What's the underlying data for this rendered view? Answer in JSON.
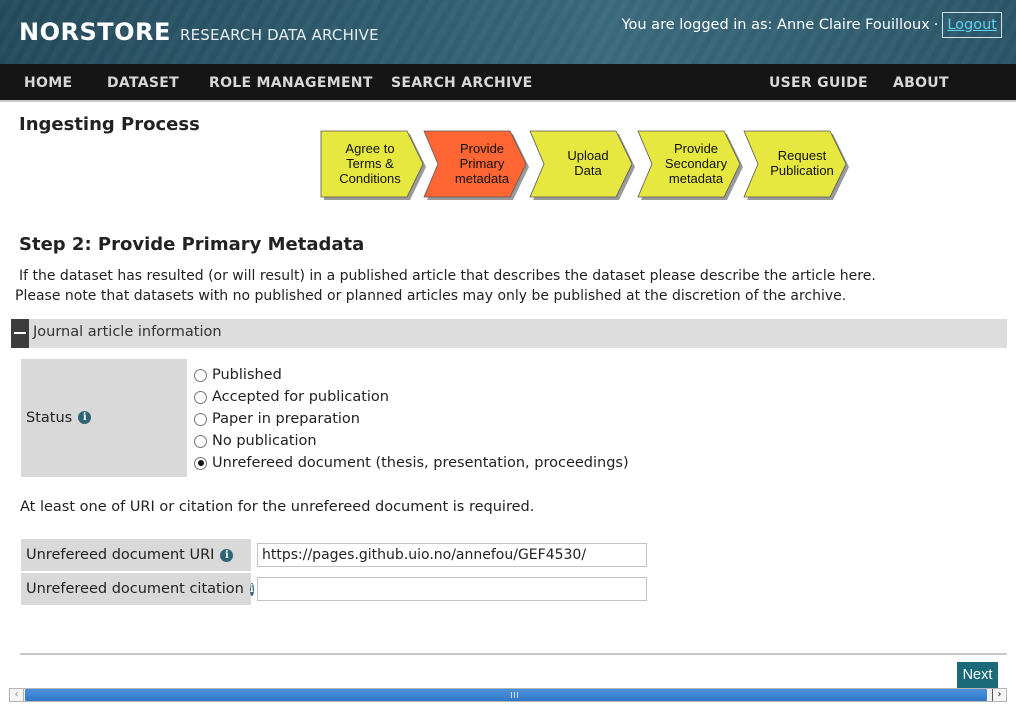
{
  "header": {
    "brand_bold": "NORSTORE",
    "brand_light": "RESEARCH DATA ARCHIVE",
    "logged_in_text": "You are logged in as: Anne Claire Fouilloux",
    "separator": "·",
    "logout_label": "Logout",
    "colors": {
      "header_bg": "#2e5b6e",
      "logout_link": "#5ed1f0"
    }
  },
  "nav": {
    "left": [
      "HOME",
      "DATASET",
      "ROLE MANAGEMENT",
      "SEARCH ARCHIVE"
    ],
    "right": [
      "USER GUIDE",
      "ABOUT"
    ]
  },
  "ingest": {
    "title": "Ingesting Process",
    "steps": [
      {
        "lines": [
          "Agree to",
          "Terms &",
          "Conditions"
        ],
        "color": "#e6e840",
        "active": false
      },
      {
        "lines": [
          "Provide",
          "Primary",
          "metadata"
        ],
        "color": "#ff6633",
        "active": true
      },
      {
        "lines": [
          "Upload",
          "Data"
        ],
        "color": "#e6e840",
        "active": false
      },
      {
        "lines": [
          "Provide",
          "Secondary",
          "metadata"
        ],
        "color": "#e6e840",
        "active": false
      },
      {
        "lines": [
          "Request",
          "Publication"
        ],
        "color": "#e6e840",
        "active": false
      }
    ]
  },
  "step2": {
    "title": "Step 2: Provide Primary Metadata",
    "intro_line1": "If the dataset has resulted (or will result) in a published article that describes the dataset please describe the article here.",
    "intro_line2": "Please note that datasets with no published or planned articles may only be published at the discretion of the archive."
  },
  "journal_section": {
    "title": "Journal article information",
    "status_label": "Status",
    "status_options": [
      {
        "label": "Published",
        "checked": false
      },
      {
        "label": "Accepted for publication",
        "checked": false
      },
      {
        "label": "Paper in preparation",
        "checked": false
      },
      {
        "label": "No publication",
        "checked": false
      },
      {
        "label": "Unrefereed document (thesis, presentation, proceedings)",
        "checked": true
      }
    ],
    "note": "At least one of URI or citation for the unrefereed document is required.",
    "uri_label": "Unrefereed document URI",
    "uri_value": "https://pages.github.uio.no/annefou/GEF4530/",
    "citation_label": "Unrefereed document citation",
    "citation_value": ""
  },
  "footer": {
    "next_label": "Next"
  },
  "icons": {
    "info": "info-icon",
    "collapse": "minus-icon"
  }
}
